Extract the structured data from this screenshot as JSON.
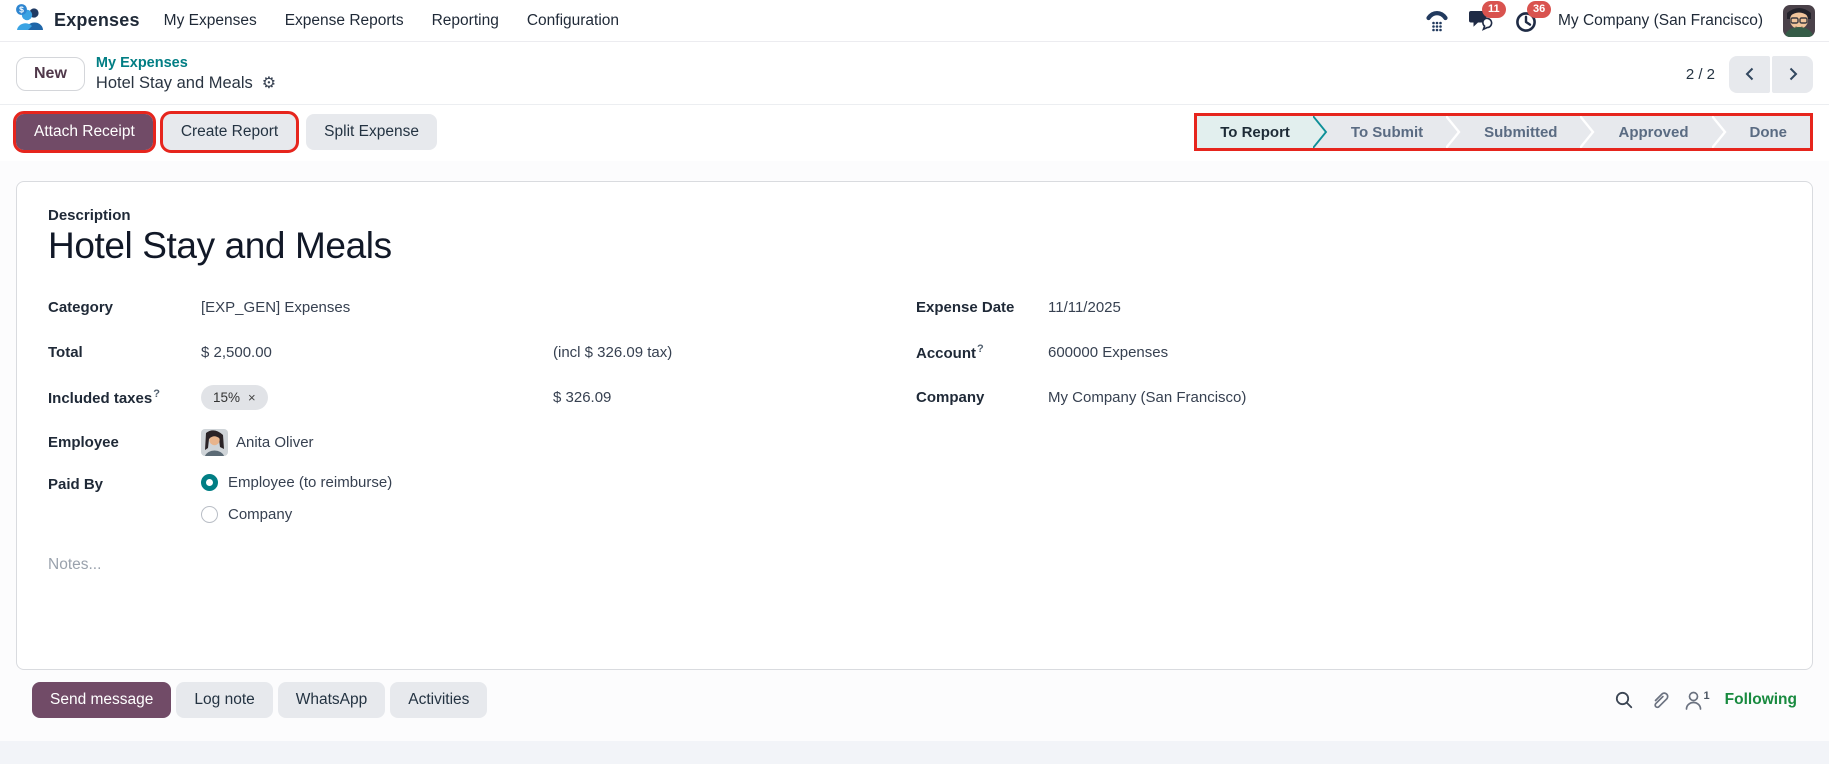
{
  "colors": {
    "accent": "#714B67",
    "link_teal": "#017E84",
    "highlight_red": "#E6251D",
    "badge_red": "#D9534F",
    "following_green": "#188A3F",
    "stage_active_bg": "#E2EFEE"
  },
  "navbar": {
    "app_name": "Expenses",
    "menu_items": [
      {
        "label": "My Expenses"
      },
      {
        "label": "Expense Reports"
      },
      {
        "label": "Reporting"
      },
      {
        "label": "Configuration"
      }
    ],
    "badges": {
      "messages": "11",
      "activities": "36"
    },
    "company_name": "My Company (San Francisco)"
  },
  "breadcrumb": {
    "new_label": "New",
    "parent": "My Expenses",
    "current": "Hotel Stay and Meals"
  },
  "pager": {
    "value": "2 / 2"
  },
  "actions": {
    "attach_receipt": "Attach Receipt",
    "create_report": "Create Report",
    "split_expense": "Split Expense"
  },
  "statusbar": {
    "stages": [
      {
        "label": "To Report",
        "active": true
      },
      {
        "label": "To Submit",
        "active": false
      },
      {
        "label": "Submitted",
        "active": false
      },
      {
        "label": "Approved",
        "active": false
      },
      {
        "label": "Done",
        "active": false
      }
    ]
  },
  "form": {
    "description_label": "Description",
    "title": "Hotel Stay and Meals",
    "category": {
      "label": "Category",
      "value": "[EXP_GEN] Expenses"
    },
    "total": {
      "label": "Total",
      "value": "$ 2,500.00",
      "tax_note": "(incl $ 326.09 tax)"
    },
    "included_taxes": {
      "label": "Included taxes",
      "help": "?",
      "tag": "15%",
      "remove": "×",
      "amount": "$ 326.09"
    },
    "employee": {
      "label": "Employee",
      "value": "Anita Oliver"
    },
    "paid_by": {
      "label": "Paid By",
      "options": [
        {
          "label": "Employee (to reimburse)",
          "selected": true
        },
        {
          "label": "Company",
          "selected": false
        }
      ]
    },
    "notes_placeholder": "Notes...",
    "expense_date": {
      "label": "Expense Date",
      "value": "11/11/2025"
    },
    "account": {
      "label": "Account",
      "help": "?",
      "value": "600000 Expenses"
    },
    "company": {
      "label": "Company",
      "value": "My Company (San Francisco)"
    }
  },
  "chatter": {
    "send_message": "Send message",
    "log_note": "Log note",
    "whatsapp": "WhatsApp",
    "activities": "Activities",
    "followers_count": "1",
    "following_label": "Following"
  }
}
